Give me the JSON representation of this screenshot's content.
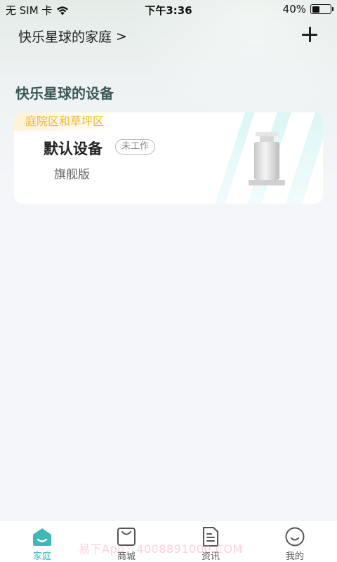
{
  "status_bar": {
    "carrier": "无 SIM 卡",
    "time": "下午3:36",
    "battery_percent": "40%",
    "battery_level": 0.4
  },
  "header": {
    "family_name": "快乐星球的家庭",
    "chevron": ">"
  },
  "section": {
    "title": "快乐星球的设备"
  },
  "device": {
    "zone": "庭院区和草坪区",
    "name": "默认设备",
    "status": "未工作",
    "model": "旗舰版"
  },
  "nav": {
    "items": [
      {
        "label": "家庭",
        "icon": "home-icon",
        "active": true
      },
      {
        "label": "商城",
        "icon": "shopping-bag-icon",
        "active": false
      },
      {
        "label": "资讯",
        "icon": "document-icon",
        "active": false
      },
      {
        "label": "我的",
        "icon": "smiley-face-icon",
        "active": false
      }
    ],
    "active_color": "#3fb8b8"
  },
  "watermark": "易下App：4008891000.COM"
}
